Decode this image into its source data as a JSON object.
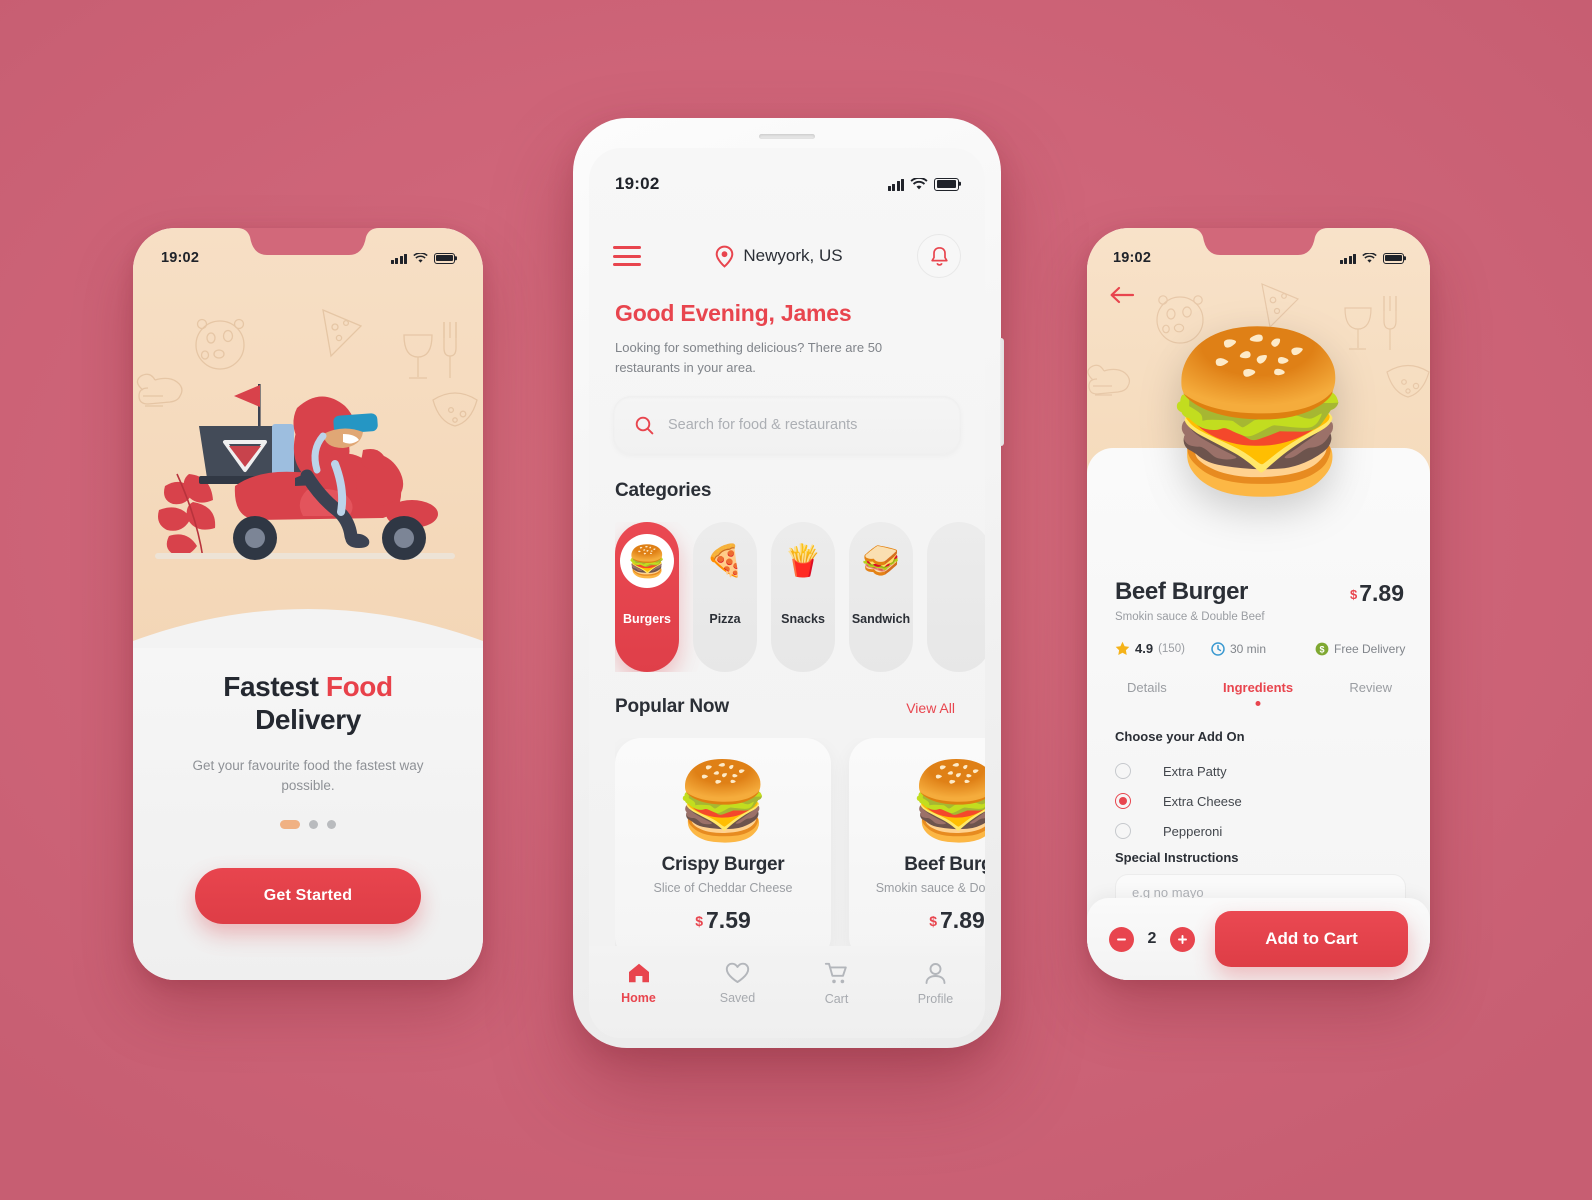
{
  "theme": {
    "background": "#D2687A",
    "accent": "#E8454E",
    "cream": "#F5DCBE",
    "dark": "#2B2F36",
    "muted": "#9A9DA2"
  },
  "status_bar": {
    "time": "19:02"
  },
  "onboarding": {
    "title_part1": "Fastest ",
    "title_highlight": "Food",
    "title_part2": "Delivery",
    "subtitle": "Get your favourite food the fastest way possible.",
    "cta_label": "Get Started",
    "dots_total": 3,
    "dots_active_index": 0
  },
  "home": {
    "location": "Newyork, US",
    "greeting": "Good Evening, James",
    "greeting_sub": "Looking for something delicious? There are 50 restaurants in your area.",
    "search_placeholder": "Search for food & restaurants",
    "search_value": "",
    "categories_title": "Categories",
    "categories": [
      {
        "label": "Burgers",
        "emoji": "🍔",
        "active": true
      },
      {
        "label": "Pizza",
        "emoji": "🍕",
        "active": false
      },
      {
        "label": "Snacks",
        "emoji": "🍟",
        "active": false
      },
      {
        "label": "Sandwich",
        "emoji": "🥪",
        "active": false
      },
      {
        "label": "",
        "emoji": "",
        "active": false
      }
    ],
    "popular_title": "Popular Now",
    "view_all_label": "View All",
    "popular_items": [
      {
        "name": "Crispy Burger",
        "desc": "Slice of Cheddar Cheese",
        "currency": "$",
        "price": "7.59",
        "emoji": "🍔"
      },
      {
        "name": "Beef Burger",
        "desc": "Smokin sauce & Double Beef",
        "currency": "$",
        "price": "7.89",
        "emoji": "🍔"
      }
    ],
    "tabs": [
      {
        "label": "Home",
        "icon": "home-icon",
        "active": true
      },
      {
        "label": "Saved",
        "icon": "heart-icon",
        "active": false
      },
      {
        "label": "Cart",
        "icon": "cart-icon",
        "active": false
      },
      {
        "label": "Profile",
        "icon": "person-icon",
        "active": false
      }
    ]
  },
  "detail": {
    "product_name": "Beef Burger",
    "product_desc": "Smokin sauce & Double Beef",
    "currency": "$",
    "price": "7.89",
    "hero_emoji": "🍔",
    "rating": "4.9",
    "rating_count": "(150)",
    "prep_time": "30 min",
    "delivery": "Free Delivery",
    "tabs": [
      {
        "label": "Details",
        "active": false
      },
      {
        "label": "Ingredients",
        "active": true
      },
      {
        "label": "Review",
        "active": false
      }
    ],
    "addon_title": "Choose your Add On",
    "addons": [
      {
        "label": "Extra Patty",
        "selected": false
      },
      {
        "label": "Extra Cheese",
        "selected": true
      },
      {
        "label": "Pepperoni",
        "selected": false
      }
    ],
    "special_title": "Special Instructions",
    "special_placeholder": "e.g no mayo",
    "special_value": "",
    "quantity": "2",
    "add_to_cart_label": "Add to Cart"
  }
}
